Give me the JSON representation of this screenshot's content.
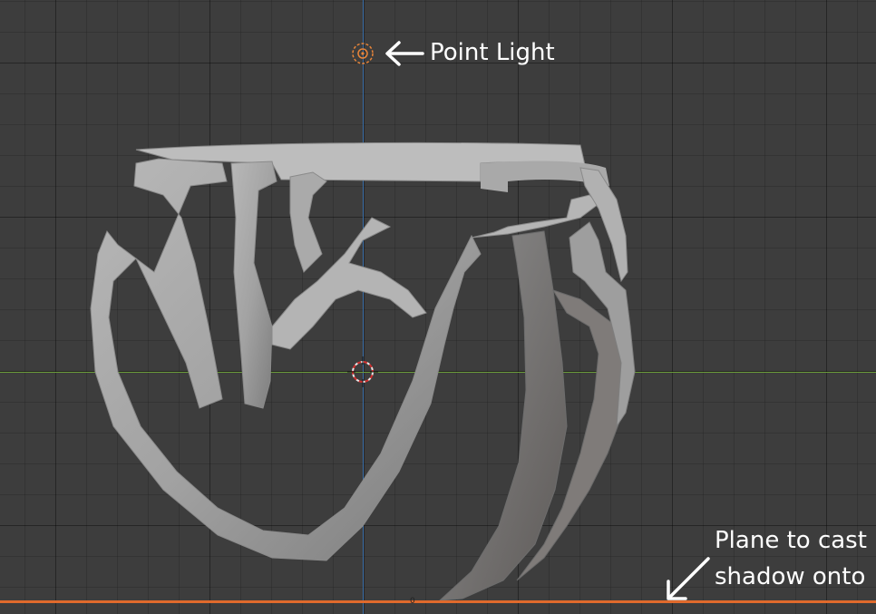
{
  "viewport": {
    "background_color": "#3d3d3d",
    "y_axis_color": "#3b6fa8",
    "x_axis_color": "#6a9a3a",
    "ground_plane_color": "#e06a2c",
    "light_color": "#e8853a",
    "model_color": "#a4a4a4",
    "origin_marker": "0"
  },
  "annotations": {
    "point_light": "Point Light",
    "plane_line_1": "Plane to cast",
    "plane_line_2": "shadow onto"
  },
  "icons": {
    "point_light": "point-light-icon",
    "cursor": "3d-cursor-icon",
    "arrow_left": "arrow-left-icon",
    "arrow_down_left": "arrow-down-left-icon"
  }
}
